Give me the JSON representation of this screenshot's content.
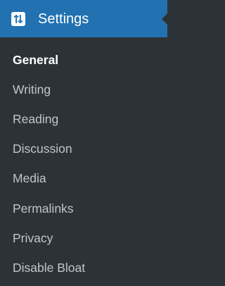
{
  "header": {
    "title": "Settings",
    "icon": "settings-sliders-icon",
    "background": "#2271b1"
  },
  "submenu": {
    "current_index": 0,
    "items": [
      {
        "label": "General",
        "current": true
      },
      {
        "label": "Writing"
      },
      {
        "label": "Reading"
      },
      {
        "label": "Discussion"
      },
      {
        "label": "Media"
      },
      {
        "label": "Permalinks"
      },
      {
        "label": "Privacy"
      },
      {
        "label": "Disable Bloat"
      }
    ]
  },
  "colors": {
    "menu_background": "#2c3338",
    "item_text": "#c3c4c7",
    "current_text": "#ffffff",
    "header_background": "#2271b1"
  }
}
